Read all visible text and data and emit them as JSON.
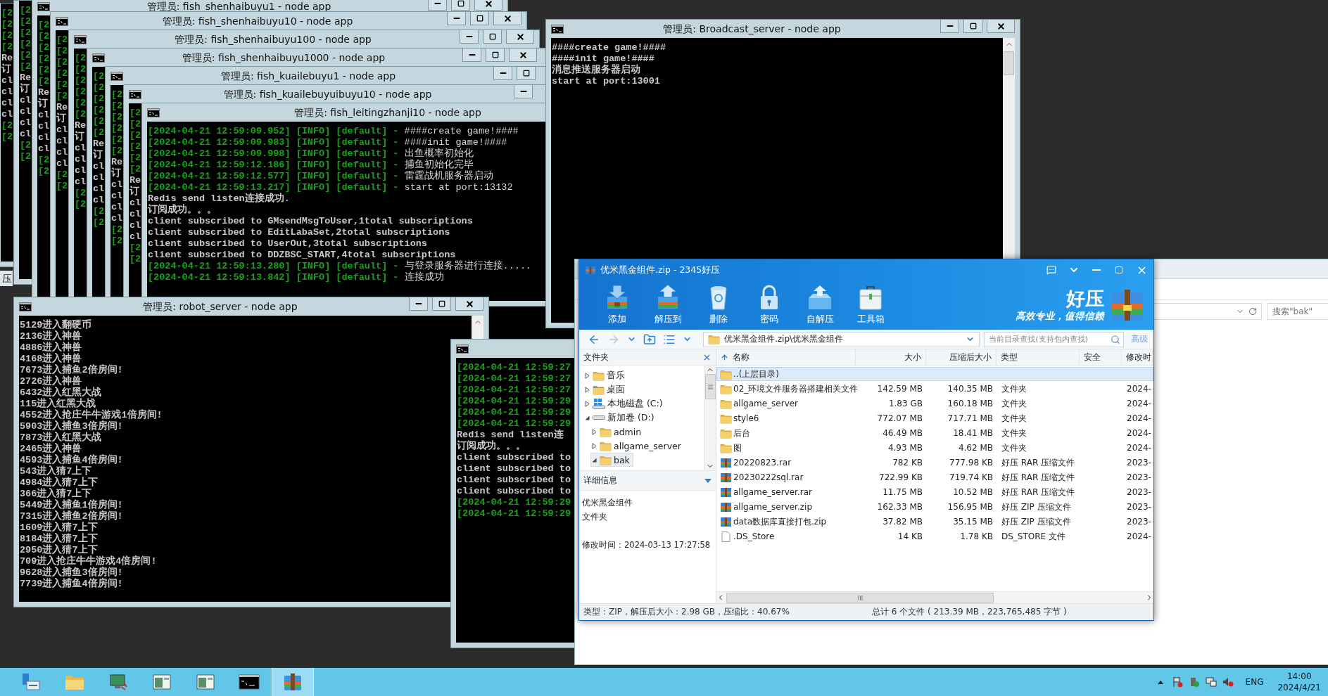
{
  "desktop_fragment": "压",
  "consoles": [
    {
      "lines": [
        {
          "kind": "log",
          "text": "[2"
        },
        {
          "kind": "log",
          "text": "[2"
        },
        {
          "kind": "log",
          "text": "[2"
        },
        {
          "kind": "log",
          "text": "[2"
        },
        {
          "kind": "plain",
          "text": "Re"
        },
        {
          "kind": "plain",
          "text": "订"
        },
        {
          "kind": "plain",
          "text": "cl"
        },
        {
          "kind": "plain",
          "text": "cl"
        },
        {
          "kind": "plain",
          "text": "cl"
        },
        {
          "kind": "plain",
          "text": "cl"
        },
        {
          "kind": "log",
          "text": "[2"
        },
        {
          "kind": "log",
          "text": "[2"
        }
      ]
    },
    {
      "lines": [
        {
          "kind": "log",
          "text": "[2"
        },
        {
          "kind": "log",
          "text": "[2"
        },
        {
          "kind": "log",
          "text": "[2"
        },
        {
          "kind": "log",
          "text": "[2"
        },
        {
          "kind": "log",
          "text": "[2"
        },
        {
          "kind": "log",
          "text": "[2"
        },
        {
          "kind": "plain",
          "text": "Re"
        },
        {
          "kind": "plain",
          "text": "订"
        },
        {
          "kind": "plain",
          "text": "cl"
        },
        {
          "kind": "plain",
          "text": "cl"
        },
        {
          "kind": "plain",
          "text": "cl"
        },
        {
          "kind": "plain",
          "text": "cl"
        },
        {
          "kind": "log",
          "text": "[2"
        },
        {
          "kind": "log",
          "text": "[2"
        }
      ]
    },
    {
      "title": "管理员: fish_shenhaibuyu1 - node app",
      "controls": [
        {
          "kind": "minimize"
        },
        {
          "kind": "maximize"
        },
        {
          "kind": "close"
        }
      ],
      "lines": [
        {
          "kind": "log",
          "text": "[2"
        },
        {
          "kind": "log",
          "text": "[2"
        },
        {
          "kind": "log",
          "text": "[2"
        },
        {
          "kind": "log",
          "text": "[2"
        },
        {
          "kind": "log",
          "text": "[2"
        },
        {
          "kind": "log",
          "text": "[2"
        },
        {
          "kind": "plain",
          "text": "Re"
        },
        {
          "kind": "plain",
          "text": "订"
        },
        {
          "kind": "plain",
          "text": "cl"
        },
        {
          "kind": "plain",
          "text": "cl"
        },
        {
          "kind": "plain",
          "text": "cl"
        },
        {
          "kind": "plain",
          "text": "cl"
        },
        {
          "kind": "log",
          "text": "[2"
        },
        {
          "kind": "log",
          "text": "[2"
        }
      ]
    },
    {
      "title": "管理员: fish_shenhaibuyu10 - node app",
      "controls": [
        {
          "kind": "minimize"
        },
        {
          "kind": "maximize"
        },
        {
          "kind": "close"
        }
      ],
      "lines": [
        {
          "kind": "log",
          "text": "[2"
        },
        {
          "kind": "log",
          "text": "[2"
        },
        {
          "kind": "log",
          "text": "[2"
        },
        {
          "kind": "log",
          "text": "[2"
        },
        {
          "kind": "log",
          "text": "[2"
        },
        {
          "kind": "log",
          "text": "[2"
        },
        {
          "kind": "plain",
          "text": "Re"
        },
        {
          "kind": "plain",
          "text": "订"
        },
        {
          "kind": "plain",
          "text": "cl"
        },
        {
          "kind": "plain",
          "text": "cl"
        },
        {
          "kind": "plain",
          "text": "cl"
        },
        {
          "kind": "plain",
          "text": "cl"
        },
        {
          "kind": "log",
          "text": "[2"
        },
        {
          "kind": "log",
          "text": "[2"
        }
      ]
    },
    {
      "title": "管理员: fish_shenhaibuyu100 - node app",
      "controls": [
        {
          "kind": "minimize"
        },
        {
          "kind": "maximize"
        },
        {
          "kind": "close"
        }
      ],
      "lines": [
        {
          "kind": "log",
          "text": "[2"
        },
        {
          "kind": "log",
          "text": "[2"
        },
        {
          "kind": "log",
          "text": "[2"
        },
        {
          "kind": "log",
          "text": "[2"
        },
        {
          "kind": "log",
          "text": "[2"
        },
        {
          "kind": "log",
          "text": "[2"
        },
        {
          "kind": "plain",
          "text": "Re"
        },
        {
          "kind": "plain",
          "text": "订"
        },
        {
          "kind": "plain",
          "text": "cl"
        },
        {
          "kind": "plain",
          "text": "cl"
        },
        {
          "kind": "plain",
          "text": "cl"
        },
        {
          "kind": "plain",
          "text": "cl"
        },
        {
          "kind": "log",
          "text": "[2"
        },
        {
          "kind": "log",
          "text": "[2"
        }
      ]
    },
    {
      "title": "管理员: fish_shenhaibuyu1000 - node app",
      "controls": [
        {
          "kind": "minimize"
        },
        {
          "kind": "maximize"
        },
        {
          "kind": "close"
        }
      ],
      "lines": [
        {
          "kind": "log",
          "text": "[2"
        },
        {
          "kind": "log",
          "text": "[2"
        },
        {
          "kind": "log",
          "text": "[2"
        },
        {
          "kind": "log",
          "text": "[2"
        },
        {
          "kind": "log",
          "text": "[2"
        },
        {
          "kind": "log",
          "text": "[2"
        },
        {
          "kind": "plain",
          "text": "Re"
        },
        {
          "kind": "plain",
          "text": "订"
        },
        {
          "kind": "plain",
          "text": "cl"
        },
        {
          "kind": "plain",
          "text": "cl"
        },
        {
          "kind": "plain",
          "text": "cl"
        },
        {
          "kind": "plain",
          "text": "cl"
        },
        {
          "kind": "log",
          "text": "[2"
        },
        {
          "kind": "log",
          "text": "[2"
        }
      ]
    },
    {
      "title": "管理员: fish_kuailebuyu1 - node app",
      "controls": [
        {
          "kind": "minimize"
        },
        {
          "kind": "maximize"
        }
      ],
      "lines": [
        {
          "kind": "log",
          "text": "[2"
        },
        {
          "kind": "log",
          "text": "[2"
        },
        {
          "kind": "log",
          "text": "[2"
        },
        {
          "kind": "log",
          "text": "[2"
        },
        {
          "kind": "log",
          "text": "[2"
        },
        {
          "kind": "log",
          "text": "[2"
        },
        {
          "kind": "plain",
          "text": "Re"
        },
        {
          "kind": "plain",
          "text": "订"
        },
        {
          "kind": "plain",
          "text": "cl"
        },
        {
          "kind": "plain",
          "text": "cl"
        },
        {
          "kind": "plain",
          "text": "cl"
        },
        {
          "kind": "plain",
          "text": "cl"
        },
        {
          "kind": "log",
          "text": "[2"
        },
        {
          "kind": "log",
          "text": "[2"
        }
      ]
    },
    {
      "title": "管理员: fish_kuailebuyuibuyu10 - node app",
      "controls": [
        {
          "kind": "minimize"
        }
      ],
      "lines": [
        {
          "kind": "log",
          "text": "[2"
        },
        {
          "kind": "log",
          "text": "[2"
        },
        {
          "kind": "log",
          "text": "[2"
        },
        {
          "kind": "log",
          "text": "[2"
        },
        {
          "kind": "log",
          "text": "[2"
        },
        {
          "kind": "log",
          "text": "[2"
        },
        {
          "kind": "plain",
          "text": "Re"
        },
        {
          "kind": "plain",
          "text": "订"
        },
        {
          "kind": "plain",
          "text": "cl"
        },
        {
          "kind": "plain",
          "text": "cl"
        },
        {
          "kind": "plain",
          "text": "cl"
        },
        {
          "kind": "plain",
          "text": "cl"
        },
        {
          "kind": "log",
          "text": "[2"
        },
        {
          "kind": "log",
          "text": "[2"
        }
      ]
    },
    {
      "title": "管理员: fish_leitingzhanji10 - node app",
      "lines": [
        {
          "kind": "log",
          "text": "[2024-04-21 12:59:09.952] [INFO] [default] -",
          "message": "####create game!####"
        },
        {
          "kind": "log",
          "text": "[2024-04-21 12:59:09.983] [INFO] [default] -",
          "message": "####init game!####"
        },
        {
          "kind": "log",
          "text": "[2024-04-21 12:59:09.998] [INFO] [default] -",
          "message": "出鱼概率初始化"
        },
        {
          "kind": "log",
          "text": "[2024-04-21 12:59:12.186] [INFO] [default] -",
          "message": "捕鱼初始化完毕"
        },
        {
          "kind": "log",
          "text": "[2024-04-21 12:59:12.577] [INFO] [default] -",
          "message": "雷霆战机服务器启动"
        },
        {
          "kind": "log",
          "text": "[2024-04-21 12:59:13.217] [INFO] [default] -",
          "message": "start at port:13132"
        },
        {
          "kind": "plain",
          "text": "Redis send listen连接成功."
        },
        {
          "kind": "plain",
          "text": "订阅成功。。。"
        },
        {
          "kind": "plain",
          "text": "client subscribed to GMsendMsgToUser,1total subscriptions"
        },
        {
          "kind": "plain",
          "text": "client subscribed to EditLabaSet,2total subscriptions"
        },
        {
          "kind": "plain",
          "text": "client subscribed to UserOut,3total subscriptions"
        },
        {
          "kind": "plain",
          "text": "client subscribed to DDZBSC_START,4total subscriptions"
        },
        {
          "kind": "log",
          "text": "[2024-04-21 12:59:13.280] [INFO] [default] -",
          "message": "与登录服务器进行连接....."
        },
        {
          "kind": "log",
          "text": "[2024-04-21 12:59:13.842] [INFO] [default] -",
          "message": "连接成功"
        }
      ]
    },
    {
      "title": "管理员: Broadcast_server - node app",
      "controls": [
        {
          "kind": "minimize"
        },
        {
          "kind": "maximize"
        },
        {
          "kind": "close"
        }
      ],
      "lines": [
        {
          "kind": "plain",
          "text": "####create game!####"
        },
        {
          "kind": "plain",
          "text": "####init game!####"
        },
        {
          "kind": "plain",
          "text": "消息推送服务器启动"
        },
        {
          "kind": "plain",
          "text": "start at port:13001"
        }
      ]
    },
    {
      "title": "管理员: robot_server - node app",
      "controls": [
        {
          "kind": "minimize"
        },
        {
          "kind": "maximize"
        },
        {
          "kind": "close"
        }
      ],
      "lines": [
        {
          "kind": "plain",
          "text": "5129进入翻硬币"
        },
        {
          "kind": "plain",
          "text": "2136进入神兽"
        },
        {
          "kind": "plain",
          "text": "4886进入神兽"
        },
        {
          "kind": "plain",
          "text": "4168进入神兽"
        },
        {
          "kind": "plain",
          "text": "7673进入捕鱼2倍房间!"
        },
        {
          "kind": "plain",
          "text": "2726进入神兽"
        },
        {
          "kind": "plain",
          "text": "6432进入红黑大战"
        },
        {
          "kind": "plain",
          "text": "115进入红黑大战"
        },
        {
          "kind": "plain",
          "text": "4552进入抢庄牛牛游戏1倍房间!"
        },
        {
          "kind": "plain",
          "text": "5903进入捕鱼3倍房间!"
        },
        {
          "kind": "plain",
          "text": "7873进入红黑大战"
        },
        {
          "kind": "plain",
          "text": "2465进入神兽"
        },
        {
          "kind": "plain",
          "text": "4593进入捕鱼4倍房间!"
        },
        {
          "kind": "plain",
          "text": "543进入猜7上下"
        },
        {
          "kind": "plain",
          "text": "4984进入猜7上下"
        },
        {
          "kind": "plain",
          "text": "366进入猜7上下"
        },
        {
          "kind": "plain",
          "text": "5449进入捕鱼1倍房间!"
        },
        {
          "kind": "plain",
          "text": "7315进入捕鱼2倍房间!"
        },
        {
          "kind": "plain",
          "text": "1609进入猜7上下"
        },
        {
          "kind": "plain",
          "text": "8184进入猜7上下"
        },
        {
          "kind": "plain",
          "text": "2950进入猜7上下"
        },
        {
          "kind": "plain",
          "text": "709进入抢庄牛牛游戏4倍房间!"
        },
        {
          "kind": "plain",
          "text": "9628进入捕鱼3倍房间!"
        },
        {
          "kind": "plain",
          "text": "7739进入捕鱼4倍房间!"
        }
      ]
    },
    {
      "lines": [
        {
          "kind": "log",
          "text": "[2024-04-21 12:59:27"
        },
        {
          "kind": "log",
          "text": "[2024-04-21 12:59:27"
        },
        {
          "kind": "log",
          "text": "[2024-04-21 12:59:27"
        },
        {
          "kind": "log",
          "text": "[2024-04-21 12:59:29"
        },
        {
          "kind": "log",
          "text": "[2024-04-21 12:59:29"
        },
        {
          "kind": "log",
          "text": "[2024-04-21 12:59:29"
        },
        {
          "kind": "plain",
          "text": "Redis send listen连"
        },
        {
          "kind": "plain",
          "text": "订阅成功。。。"
        },
        {
          "kind": "plain",
          "text": "client subscribed to"
        },
        {
          "kind": "plain",
          "text": "client subscribed to"
        },
        {
          "kind": "plain",
          "text": "client subscribed to"
        },
        {
          "kind": "plain",
          "text": "client subscribed to"
        },
        {
          "kind": "log",
          "text": "[2024-04-21 12:59:29"
        },
        {
          "kind": "log",
          "text": "[2024-04-21 12:59:29"
        }
      ]
    }
  ],
  "explorer_window": {
    "search": {
      "placeholder": "搜索\"bak\""
    }
  },
  "archive_window": {
    "title": "优米黑金组件.zip - 2345好压",
    "toolbar": [
      {
        "label": "添加",
        "kind": "add"
      },
      {
        "label": "解压到",
        "kind": "extract"
      },
      {
        "label": "删除",
        "kind": "delete"
      },
      {
        "label": "密码",
        "kind": "password"
      },
      {
        "label": "自解压",
        "kind": "sfx"
      },
      {
        "label": "工具箱",
        "kind": "toolbox"
      }
    ],
    "brand": {
      "name": "好压",
      "slogan": "高效专业，值得信赖"
    },
    "address": "优米黑金组件.zip\\优米黑金组件",
    "search": {
      "placeholder": "当前目录查找(支持包内查找)"
    },
    "advanced_link": "高级",
    "folder_panel": {
      "title": "文件夹",
      "tree": [
        {
          "label": "音乐",
          "kind": "music",
          "expanded": false,
          "selected": false
        },
        {
          "label": "桌面",
          "kind": "desktop",
          "expanded": false,
          "selected": false
        },
        {
          "label": "本地磁盘 (C:)",
          "kind": "system-drive",
          "expanded": false,
          "selected": false
        },
        {
          "label": "新加卷 (D:)",
          "kind": "drive",
          "expanded": true,
          "selected": false,
          "children": [
            {
              "label": "admin",
              "kind": "folder",
              "expanded": false,
              "selected": false
            },
            {
              "label": "allgame_server",
              "kind": "folder",
              "expanded": false,
              "selected": false
            },
            {
              "label": "bak",
              "kind": "folder",
              "expanded": true,
              "selected": true
            }
          ]
        }
      ]
    },
    "details": {
      "title": "详细信息",
      "name": "优米黑金组件",
      "type": "文件夹",
      "modified": "修改时间：2024-03-13 17:27:58"
    },
    "columns": [
      {
        "label": "名称",
        "sorted": true
      },
      {
        "label": "大小",
        "sorted": false
      },
      {
        "label": "压缩后大小",
        "sorted": false
      },
      {
        "label": "类型",
        "sorted": false
      },
      {
        "label": "安全",
        "sorted": false
      },
      {
        "label": "修改时",
        "sorted": false
      }
    ],
    "rows": [
      {
        "kind": "parent",
        "name": "..(上层目录)",
        "selected": true
      },
      {
        "kind": "folder",
        "name": "02_环境文件服务器搭建相关文件",
        "size": "142.59 MB",
        "packed": "140.35 MB",
        "type": "文件夹",
        "modified": "2024-",
        "selected": false
      },
      {
        "kind": "folder",
        "name": "allgame_server",
        "size": "1.83 GB",
        "packed": "160.18 MB",
        "type": "文件夹",
        "modified": "2024-",
        "selected": false
      },
      {
        "kind": "folder",
        "name": "style6",
        "size": "772.07 MB",
        "packed": "717.71 MB",
        "type": "文件夹",
        "modified": "2024-",
        "selected": false
      },
      {
        "kind": "folder",
        "name": "后台",
        "size": "46.49 MB",
        "packed": "18.41 MB",
        "type": "文件夹",
        "modified": "2024-",
        "selected": false
      },
      {
        "kind": "folder",
        "name": "图",
        "size": "4.93 MB",
        "packed": "4.62 MB",
        "type": "文件夹",
        "modified": "2024-",
        "selected": false
      },
      {
        "kind": "archive",
        "name": "20220823.rar",
        "size": "782 KB",
        "packed": "777.98 KB",
        "type": "好压 RAR 压缩文件",
        "modified": "2023-",
        "selected": false
      },
      {
        "kind": "archive",
        "name": "20230222sql.rar",
        "size": "722.99 KB",
        "packed": "719.74 KB",
        "type": "好压 RAR 压缩文件",
        "modified": "2023-",
        "selected": false
      },
      {
        "kind": "archive",
        "name": "allgame_server.rar",
        "size": "11.75 MB",
        "packed": "10.52 MB",
        "type": "好压 RAR 压缩文件",
        "modified": "2023-",
        "selected": false
      },
      {
        "kind": "archive",
        "name": "allgame_server.zip",
        "size": "162.33 MB",
        "packed": "156.95 MB",
        "type": "好压 ZIP 压缩文件",
        "modified": "2023-",
        "selected": false
      },
      {
        "kind": "archive",
        "name": "data数据库直接打包.zip",
        "size": "37.82 MB",
        "packed": "35.15 MB",
        "type": "好压 ZIP 压缩文件",
        "modified": "2023-",
        "selected": false
      },
      {
        "kind": "file",
        "name": ".DS_Store",
        "size": "14 KB",
        "packed": "1.78 KB",
        "type": "DS_STORE 文件",
        "modified": "2024-",
        "selected": false
      }
    ],
    "status": {
      "left": "类型：ZIP，解压后大小：2.98 GB，压缩比：40.67%",
      "right": "总计 6 个文件 ( 213.39 MB，223,765,485 字节 )"
    }
  },
  "taskbar": {
    "items": [
      {
        "kind": "server",
        "selected": false
      },
      {
        "kind": "folder",
        "selected": false
      },
      {
        "kind": "remote",
        "selected": false
      },
      {
        "kind": "window",
        "selected": false
      },
      {
        "kind": "window",
        "selected": false
      },
      {
        "kind": "console",
        "selected": false
      },
      {
        "kind": "archive",
        "selected": true
      }
    ],
    "language": "ENG",
    "time": "14:00",
    "date": "2024/4/21"
  }
}
